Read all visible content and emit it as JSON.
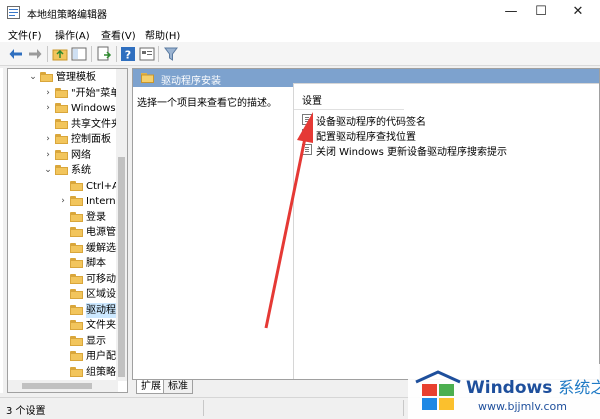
{
  "window": {
    "title": "本地组策略编辑器"
  },
  "menu": [
    "文件(F)",
    "操作(A)",
    "查看(V)",
    "帮助(H)"
  ],
  "tree": {
    "items": [
      {
        "label": "管理模板",
        "expanded": true
      },
      {
        "label": "\"开始\"菜单"
      },
      {
        "label": "Windows"
      },
      {
        "label": "共享文件夹"
      },
      {
        "label": "控制面板"
      },
      {
        "label": "网络"
      },
      {
        "label": "系统",
        "expanded": true
      },
      {
        "label": "Ctrl+Alt"
      },
      {
        "label": "Internet"
      },
      {
        "label": "登录"
      },
      {
        "label": "电源管理"
      },
      {
        "label": "缓解选项"
      },
      {
        "label": "脚本"
      },
      {
        "label": "可移动存储"
      },
      {
        "label": "区域设置"
      },
      {
        "label": "驱动程序安装",
        "selected": true
      },
      {
        "label": "文件夹重定向"
      },
      {
        "label": "显示"
      },
      {
        "label": "用户配置"
      },
      {
        "label": "组策略"
      }
    ]
  },
  "pane": {
    "header": "驱动程序安装",
    "description": "选择一个项目来查看它的描述。",
    "column_header": "设置",
    "settings": [
      "设备驱动程序的代码签名",
      "配置驱动程序查找位置",
      "关闭 Windows 更新设备驱动程序搜索提示"
    ]
  },
  "tabs": [
    "扩展",
    "标准"
  ],
  "status": {
    "text": "3 个设置"
  },
  "watermark": {
    "title": "Windows",
    "title_cn": "系统之家",
    "url": "www.bjjmlv.com"
  },
  "colors": {
    "header_bg": "#7da2ce",
    "selection": "#cce8ff",
    "arrow": "#e53935",
    "brand_blue": "#1e4f9c"
  }
}
